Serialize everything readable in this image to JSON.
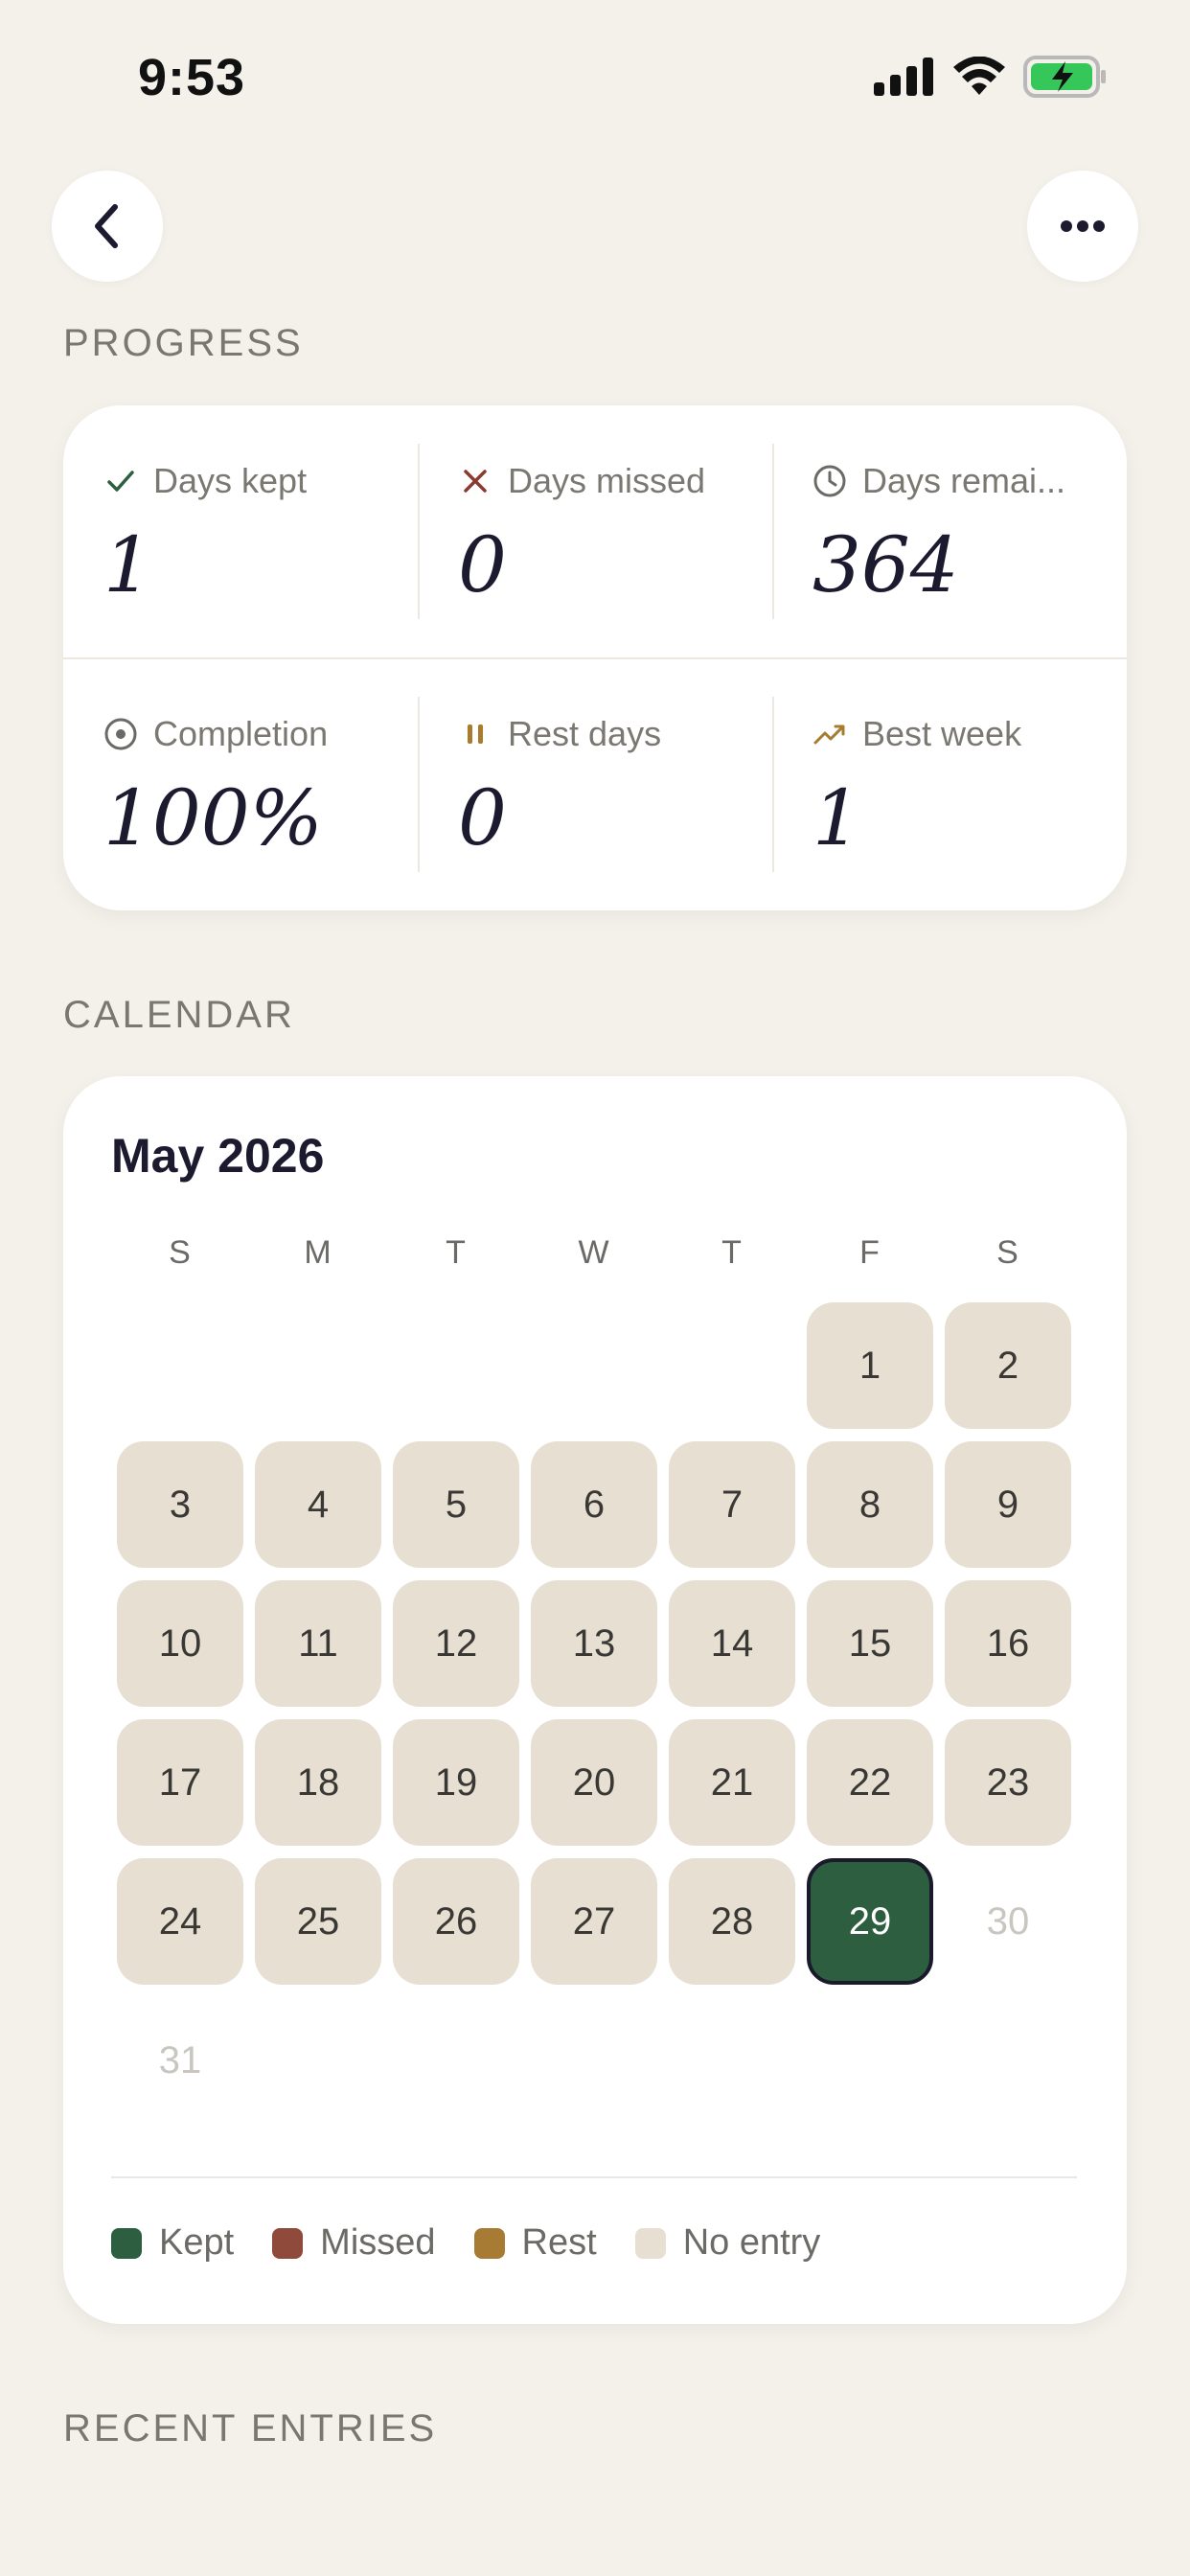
{
  "status_bar": {
    "time": "9:53"
  },
  "sections": {
    "progress": "PROGRESS",
    "calendar": "CALENDAR",
    "recent": "RECENT ENTRIES"
  },
  "stats": [
    {
      "label": "Days kept",
      "value": "1",
      "icon": "check-icon",
      "icon_color": "#2d5e40"
    },
    {
      "label": "Days missed",
      "value": "0",
      "icon": "x-icon",
      "icon_color": "#8a3a2e"
    },
    {
      "label": "Days remai...",
      "value": "364",
      "icon": "clock-icon",
      "icon_color": "#6c6a66"
    },
    {
      "label": "Completion",
      "value": "100%",
      "icon": "target-icon",
      "icon_color": "#6c6a66"
    },
    {
      "label": "Rest days",
      "value": "0",
      "icon": "pause-icon",
      "icon_color": "#a87b2f"
    },
    {
      "label": "Best week",
      "value": "1",
      "icon": "trend-up-icon",
      "icon_color": "#a87b2f"
    }
  ],
  "calendar": {
    "month": "May 2026",
    "weekdays": [
      "S",
      "M",
      "T",
      "W",
      "T",
      "F",
      "S"
    ],
    "first_weekday_index": 5,
    "days_in_month": 31,
    "today": 29,
    "legend": [
      {
        "label": "Kept",
        "color": "#2d5e40"
      },
      {
        "label": "Missed",
        "color": "#8f4a3c"
      },
      {
        "label": "Rest",
        "color": "#a87b35"
      },
      {
        "label": "No entry",
        "color": "#e6dfd2"
      }
    ]
  }
}
